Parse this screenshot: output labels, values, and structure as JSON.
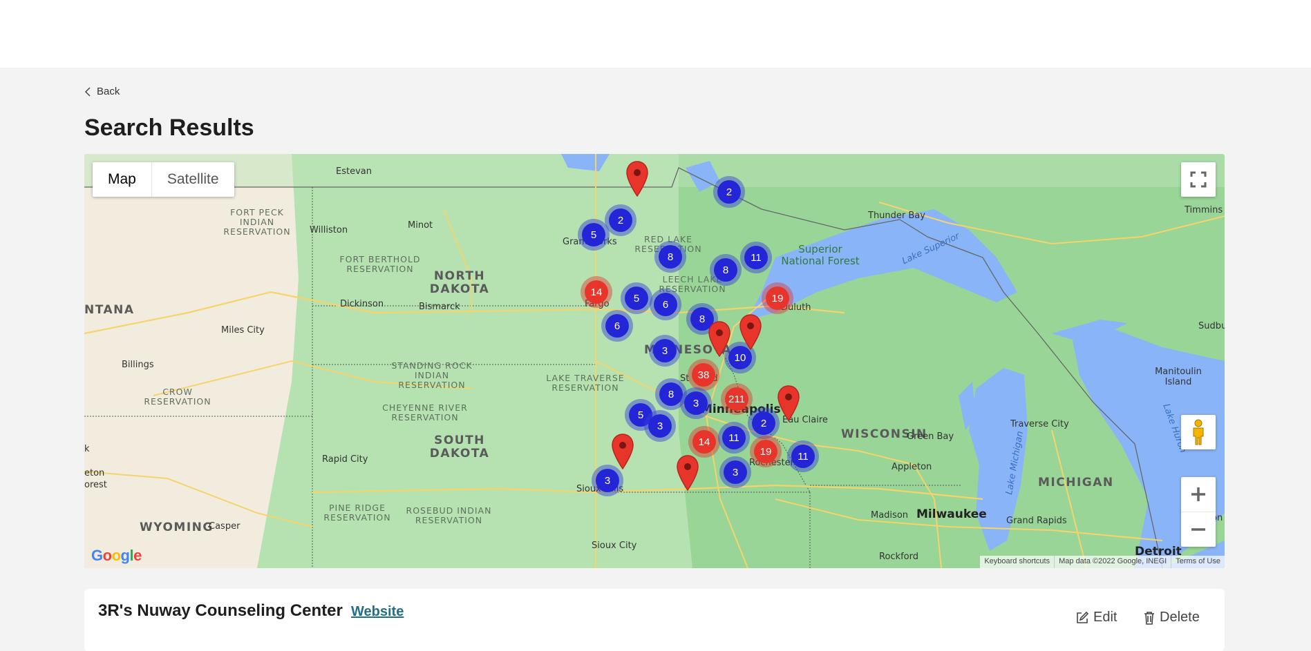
{
  "nav": {
    "back_label": "Back"
  },
  "page": {
    "title": "Search Results"
  },
  "map": {
    "map_type": {
      "map_label": "Map",
      "satellite_label": "Satellite"
    },
    "labels": {
      "states": [
        "NORTH DAKOTA",
        "SOUTH DAKOTA",
        "MINNESOTA",
        "WISCONSIN",
        "MICHIGAN",
        "WYOMING",
        "NTANA"
      ],
      "reservations": [
        "FORT PECK INDIAN RESERVATION",
        "FORT BERTHOLD RESERVATION",
        "RED LAKE RESERVATION",
        "LEECH LAKE RESERVATION",
        "STANDING ROCK INDIAN RESERVATION",
        "LAKE TRAVERSE RESERVATION",
        "CHEYENNE RIVER RESERVATION",
        "CROW RESERVATION",
        "PINE RIDGE RESERVATION",
        "ROSEBUD INDIAN RESERVATION",
        "Superior National Forest"
      ],
      "cities": [
        "Estevan",
        "Williston",
        "Minot",
        "Grand Forks",
        "Fargo",
        "Bismarck",
        "Dickinson",
        "Miles City",
        "Billings",
        "Rapid City",
        "Casper",
        "Sioux Falls",
        "Sioux City",
        "Duluth",
        "St Cloud",
        "Minneapolis",
        "Eau Claire",
        "Rochester",
        "Thunder Bay",
        "Timmins",
        "Sudbu",
        "Manitoulin Island",
        "Traverse City",
        "Green Bay",
        "Appleton",
        "Madison",
        "Milwaukee",
        "Rockford",
        "Grand Rapids",
        "Detroit",
        "ton",
        "k",
        "eton",
        "orest"
      ],
      "water": [
        "Lake Superior",
        "Lake Michigan",
        "Lake Huron"
      ]
    },
    "clusters": [
      {
        "count": "2",
        "color": "blue"
      },
      {
        "count": "2",
        "color": "blue"
      },
      {
        "count": "5",
        "color": "blue"
      },
      {
        "count": "8",
        "color": "blue"
      },
      {
        "count": "11",
        "color": "blue"
      },
      {
        "count": "8",
        "color": "blue"
      },
      {
        "count": "14",
        "color": "red"
      },
      {
        "count": "5",
        "color": "blue"
      },
      {
        "count": "6",
        "color": "blue"
      },
      {
        "count": "19",
        "color": "red"
      },
      {
        "count": "6",
        "color": "blue"
      },
      {
        "count": "8",
        "color": "blue"
      },
      {
        "count": "3",
        "color": "blue"
      },
      {
        "count": "10",
        "color": "blue"
      },
      {
        "count": "38",
        "color": "red"
      },
      {
        "count": "211",
        "color": "red"
      },
      {
        "count": "8",
        "color": "blue"
      },
      {
        "count": "3",
        "color": "blue"
      },
      {
        "count": "5",
        "color": "blue"
      },
      {
        "count": "3",
        "color": "blue"
      },
      {
        "count": "2",
        "color": "blue"
      },
      {
        "count": "14",
        "color": "red"
      },
      {
        "count": "11",
        "color": "blue"
      },
      {
        "count": "19",
        "color": "red"
      },
      {
        "count": "11",
        "color": "blue"
      },
      {
        "count": "3",
        "color": "blue"
      },
      {
        "count": "3",
        "color": "blue"
      }
    ],
    "pin_count": 6,
    "logo": "Google",
    "attribution": {
      "shortcuts": "Keyboard shortcuts",
      "data": "Map data ©2022 Google, INEGI",
      "terms": "Terms of Use"
    },
    "controls": [
      "fullscreen-icon",
      "pegman-icon",
      "zoom-in-icon",
      "zoom-out-icon"
    ]
  },
  "result": {
    "name": "3R's Nuway Counseling Center",
    "website_label": "Website",
    "edit_label": "Edit",
    "delete_label": "Delete"
  },
  "colors": {
    "cluster_blue": "#2525d8",
    "cluster_red": "#e8352b",
    "link": "#1f6f86",
    "water": "#8ab4f8",
    "land": "#a9dba8"
  }
}
